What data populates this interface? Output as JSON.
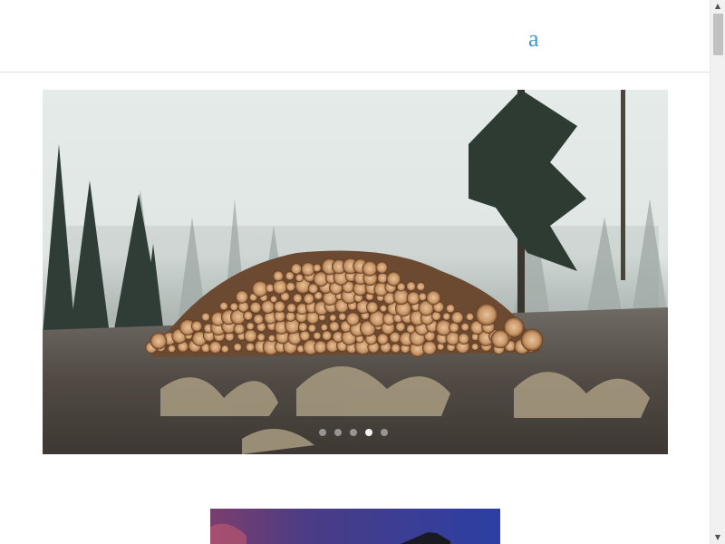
{
  "header": {
    "link_text": "a",
    "link_color": "#3d97d3"
  },
  "slider": {
    "image_description_icon": "forest-log-pile-photo",
    "dot_count": 5,
    "active_dot_index": 3
  },
  "scrollbar": {
    "up_arrow": "▲",
    "down_arrow": "▼",
    "thumb_position": 0.0
  }
}
